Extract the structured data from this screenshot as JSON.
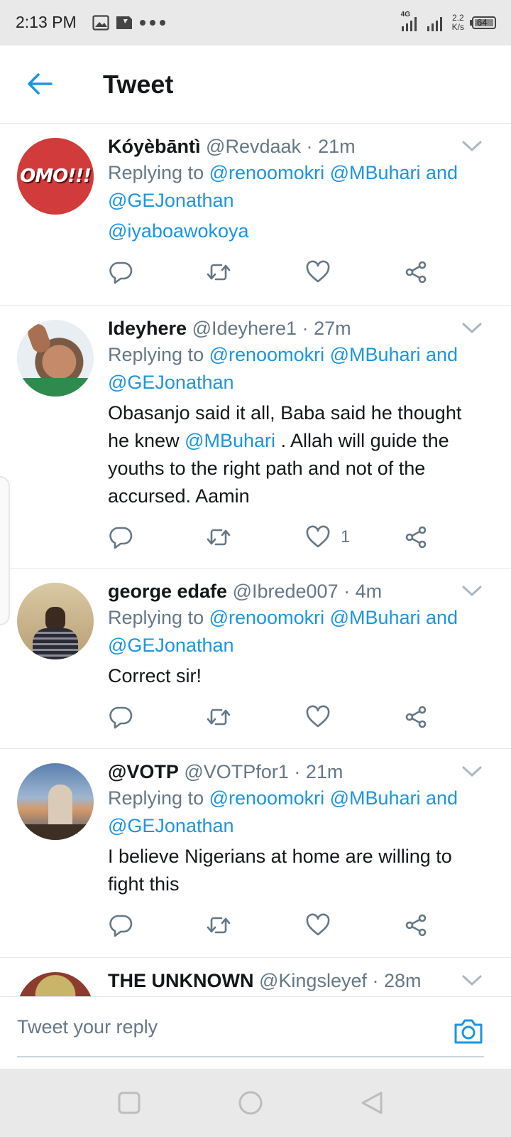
{
  "status_bar": {
    "time": "2:13 PM",
    "network": "4G",
    "net_speed_value": "2.2",
    "net_speed_unit": "K/s",
    "battery": "64"
  },
  "header": {
    "title": "Tweet"
  },
  "tweets": [
    {
      "name": "Kóyèbāntì",
      "handle": "@Revdaak",
      "time": "21m",
      "reply_prefix": "Replying to",
      "reply_mentions": "@renoomokri @MBuhari and @GEJonathan",
      "text_before": "",
      "text_mention": "@iyaboawokoya",
      "text_after": "",
      "likes": ""
    },
    {
      "name": "Ideyhere",
      "handle": "@Ideyhere1",
      "time": "27m",
      "reply_prefix": "Replying to",
      "reply_mentions": "@renoomokri @MBuhari and @GEJonathan",
      "text_before": "Obasanjo said it all, Baba said he thought he knew ",
      "text_mention": "@MBuhari",
      "text_after": " . Allah will guide the youths to the right path and not of the accursed. Aamin",
      "likes": "1"
    },
    {
      "name": "george edafe",
      "handle": "@Ibrede007",
      "time": "4m",
      "reply_prefix": "Replying to",
      "reply_mentions": "@renoomokri @MBuhari and @GEJonathan",
      "text_before": "Correct sir!",
      "text_mention": "",
      "text_after": "",
      "likes": ""
    },
    {
      "name": "@VOTP",
      "handle": "@VOTPfor1",
      "time": "21m",
      "reply_prefix": "Replying to",
      "reply_mentions": "@renoomokri @MBuhari and @GEJonathan",
      "text_before": "I believe Nigerians at home are willing to fight this",
      "text_mention": "",
      "text_after": "",
      "likes": ""
    },
    {
      "name": "THE UNKNOWN",
      "handle": "@Kingsleyef",
      "time": "28m",
      "reply_prefix": "",
      "reply_mentions": "",
      "text_before": "",
      "text_mention": "",
      "text_after": "",
      "likes": ""
    }
  ],
  "avatar_logo_text": "OMO!!!",
  "reply_bar": {
    "placeholder": "Tweet your reply"
  },
  "colors": {
    "accent": "#1b95e0",
    "muted": "#657786",
    "text": "#14171a",
    "divider": "#e1e8ed"
  }
}
